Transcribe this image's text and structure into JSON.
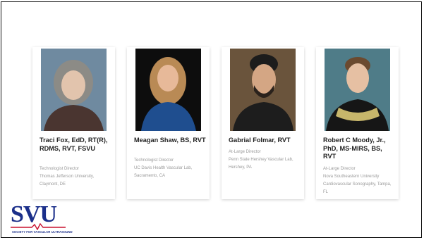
{
  "people": [
    {
      "name": "Traci Fox, EdD, RT(R), RDMS, RVT, FSVU",
      "role": "Technologist Director",
      "org": "Thomas Jefferson University, Claymont, DE"
    },
    {
      "name": "Meagan Shaw, BS, RVT",
      "role": "Technologist Director",
      "org": "UC Davis Health Vascular Lab, Sacramento, CA"
    },
    {
      "name": "Gabrial Folmar, RVT",
      "role": "At-Large Director",
      "org": "Penn State Hershey Vascular Lab, Hershey, PA"
    },
    {
      "name": "Robert C Moody, Jr., PhD, MS-MIRS, BS, RVT",
      "role": "At-Large Director",
      "org": "Nova Southeastern University Cardiovascular Sonography, Tampa, FL"
    }
  ],
  "logo": {
    "text": "SVU",
    "subtitle": "SOCIETY FOR VASCULAR ULTRASOUND",
    "color": "#1b2f8a",
    "accent": "#c8102e"
  }
}
